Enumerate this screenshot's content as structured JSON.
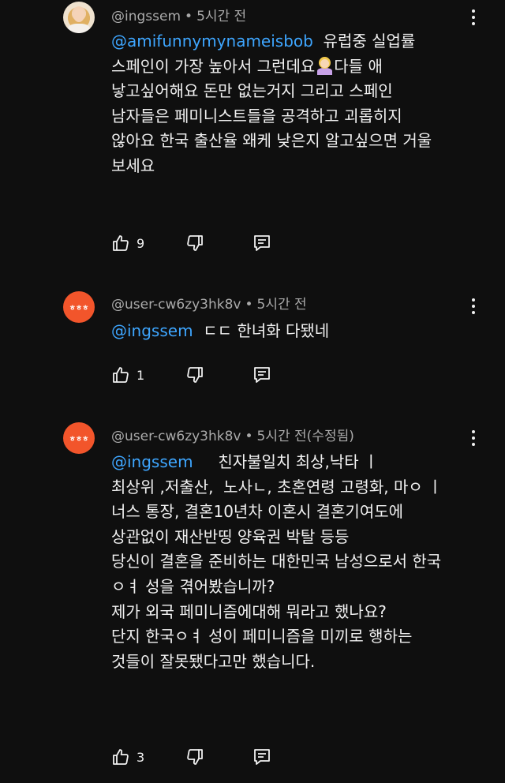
{
  "comments": [
    {
      "handle": "@ingssem",
      "time": "5시간 전",
      "avatar": "profile-photo",
      "mention": "@amifunnymynameisbob",
      "line1_rest": "  유럽중 실업률",
      "line2_a": "스페인이 가장 높아서 그런데요",
      "emoji": "person-facepalming-emoji",
      "line2_b": "다들 애",
      "lines": [
        "낳고싶어해요 돈만 없는거지 그리고 스페인",
        "남자들은 페미니스트들을 공격하고 괴롭히지",
        "않아요 한국 출산율 왜케 낮은지 알고싶으면 거울",
        "보세요"
      ],
      "likes": "9"
    },
    {
      "handle": "@user-cw6zy3hk8v",
      "time": "5시간 전",
      "avatar_text": "ㅎㅎㅎ",
      "mention": "@ingssem",
      "line1_rest": "  ㄷㄷ 한녀화 다됐네",
      "likes": "1"
    },
    {
      "handle": "@user-cw6zy3hk8v",
      "time": "5시간 전(수정됨)",
      "avatar_text": "ㅎㅎㅎ",
      "mention": "@ingssem",
      "line1_rest": "     친자불일치 최상,낙타 ㅣ",
      "lines": [
        "최상위 ,저출산,  노사ㄴ, 초혼연령 고령화, 마ㅇ ㅣ",
        "너스 통장, 결혼10년차 이혼시 결혼기여도에",
        "상관없이 재산반띵 양육권 박탈 등등",
        "당신이 결혼을 준비하는 대한민국 남성으로서 한국",
        "ㅇㅕ 성을 겪어봤습니까?",
        "제가 외국 페미니즘에대해 뭐라고 했나요?",
        "단지 한국ㅇㅕ 성이 페미니즘을 미끼로 행하는",
        "것들이 잘못됐다고만 했습니다."
      ],
      "likes": "3"
    }
  ],
  "meta_separator": "•",
  "icons": [
    "thumbs-up-icon",
    "thumbs-down-icon",
    "reply-icon",
    "more-vert-icon"
  ],
  "colors": {
    "background": "#0f0f0f",
    "mention": "#3ea6ff",
    "avatar_orange": "#f2552b",
    "meta": "#aaaaaa"
  }
}
